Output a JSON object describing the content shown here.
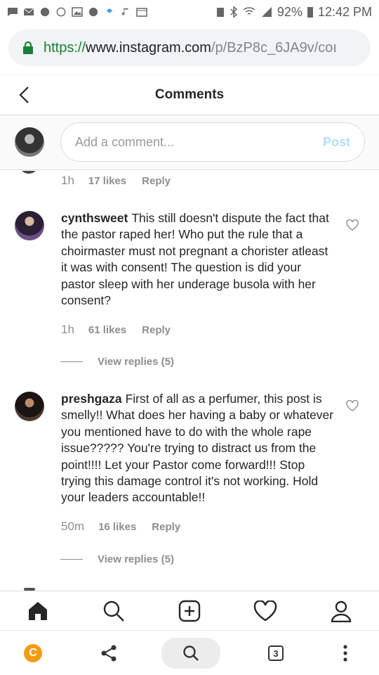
{
  "status_bar": {
    "battery": "92%",
    "time": "12:42 PM"
  },
  "browser": {
    "url_scheme": "https://",
    "url_host": "www.instagram.com",
    "url_path": "/p/BzP8c_6JA9v/coı"
  },
  "header": {
    "title": "Comments"
  },
  "composer": {
    "placeholder": "Add a comment...",
    "post_label": "Post"
  },
  "top_meta": {
    "time": "1h",
    "likes": "17 likes",
    "reply": "Reply"
  },
  "comments": [
    {
      "username": "cynthsweet",
      "text": "This still doesn't dispute the fact that the pastor raped her! Who put the rule that a choirmaster must not pregnant a chorister atleast it was with consent! The question is did your pastor sleep with her underage busola with her consent?",
      "time": "1h",
      "likes": "61 likes",
      "reply": "Reply",
      "view_replies": "View replies (5)"
    },
    {
      "username": "preshgaza",
      "text": "First of all as a perfumer, this post is smelly!! What does her having a baby or whatever you mentioned have to do with the whole rape issue????? You're trying to distract us from the point!!!! Let your Pastor come forward!!! Stop trying this damage control it's not working. Hold your leaders accountable!!",
      "time": "50m",
      "likes": "16 likes",
      "reply": "Reply",
      "view_replies": "View replies (5)"
    }
  ],
  "bottom_bar": {
    "tab_count": "3"
  },
  "colors": {
    "accent_post": "#b2dffc",
    "secure_green": "#188038",
    "c_logo": "#f39c12"
  }
}
